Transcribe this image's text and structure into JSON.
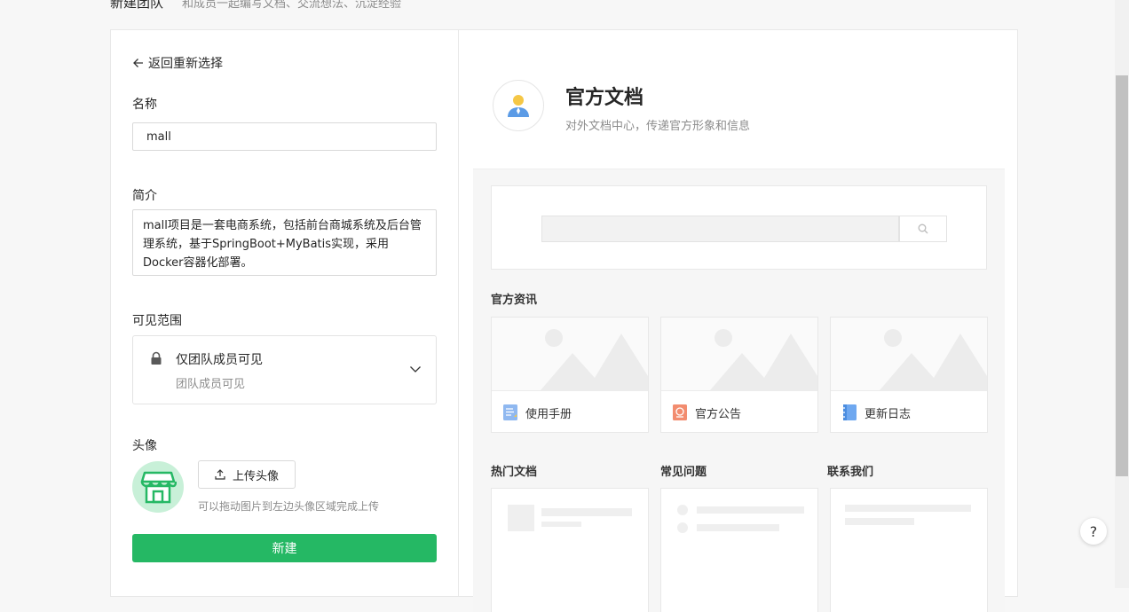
{
  "header": {
    "title": "新建团队",
    "subtitle": "和成员一起编写文档、交流想法、沉淀经验"
  },
  "form": {
    "back_label": "返回重新选择",
    "name_label": "名称",
    "name_value": "mall",
    "desc_label": "简介",
    "desc_value": "mall项目是一套电商系统，包括前台商城系统及后台管理系统，基于SpringBoot+MyBatis实现，采用Docker容器化部署。",
    "visibility_label": "可见范围",
    "visibility_title": "仅团队成员可见",
    "visibility_sub": "团队成员可见",
    "avatar_label": "头像",
    "upload_label": "上传头像",
    "upload_hint": "可以拖动图片到左边头像区域完成上传",
    "create_label": "新建"
  },
  "preview": {
    "team_title": "官方文档",
    "team_desc": "对外文档中心，传递官方形象和信息",
    "news_title": "官方资讯",
    "news": [
      {
        "label": "使用手册",
        "icon": "document-icon",
        "color": "#8fb8f0"
      },
      {
        "label": "官方公告",
        "icon": "announcement-icon",
        "color": "#f28c6f"
      },
      {
        "label": "更新日志",
        "icon": "notebook-icon",
        "color": "#6fa8f0"
      }
    ],
    "hot_docs_title": "热门文档",
    "faq_title": "常见问题",
    "contact_title": "联系我们"
  },
  "help_label": "?",
  "colors": {
    "primary": "#25b864",
    "avatar_bg": "#c8f0d8"
  }
}
